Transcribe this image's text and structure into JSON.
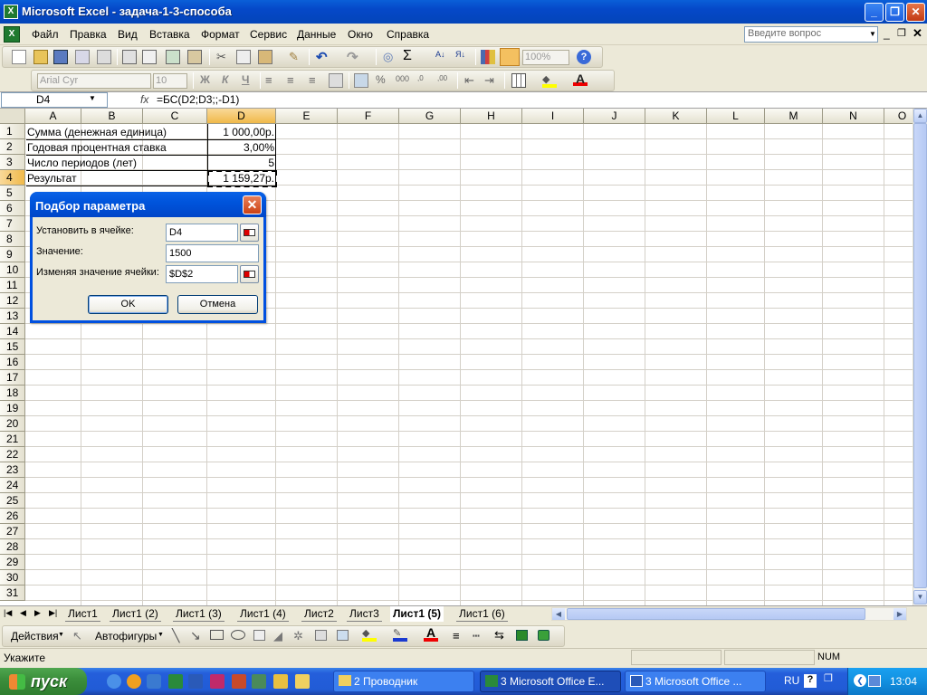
{
  "window": {
    "title": "Microsoft Excel - задача-1-3-способа"
  },
  "menu": {
    "items": [
      "Файл",
      "Правка",
      "Вид",
      "Вставка",
      "Формат",
      "Сервис",
      "Данные",
      "Окно",
      "Справка"
    ],
    "ask_placeholder": "Введите вопрос"
  },
  "toolbar": {
    "zoom": "100%",
    "font_name": "Arial Cyr",
    "font_size": "10",
    "bold": "Ж",
    "italic": "К",
    "underline": "Ч"
  },
  "formula_bar": {
    "name_box": "D4",
    "fx": "fx",
    "formula": "=БС(D2;D3;;-D1)"
  },
  "columns": [
    "A",
    "B",
    "C",
    "D",
    "E",
    "F",
    "G",
    "H",
    "I",
    "J",
    "K",
    "L",
    "M",
    "N",
    "O"
  ],
  "rows": [
    "1",
    "2",
    "3",
    "4",
    "5",
    "6",
    "7",
    "8",
    "9",
    "10",
    "11",
    "12",
    "13",
    "14",
    "15",
    "16",
    "17",
    "18",
    "19",
    "20",
    "21",
    "22",
    "23",
    "24",
    "25",
    "26",
    "27",
    "28",
    "29",
    "30",
    "31"
  ],
  "cells": {
    "A1": "Сумма (денежная единица)",
    "D1": "1 000,00р.",
    "A2": "Годовая процентная ставка",
    "D2": "3,00%",
    "A3": "Число периодов (лет)",
    "D3": "5",
    "A4": "Результат",
    "D4": "1 159,27р."
  },
  "sheet_tabs": [
    "Лист1",
    "Лист1 (2)",
    "Лист1 (3)",
    "Лист1 (4)",
    "Лист2",
    "Лист3",
    "Лист1 (5)",
    "Лист1 (6)"
  ],
  "active_tab": "Лист1 (5)",
  "draw_toolbar": {
    "actions": "Действия",
    "autoshapes": "Автофигуры"
  },
  "status": {
    "mode": "Укажите",
    "num": "NUM"
  },
  "dialog": {
    "title": "Подбор параметра",
    "set_cell_label": "Установить в ячейке:",
    "set_cell_value": "D4",
    "value_label": "Значение:",
    "value_value": "1500",
    "changing_label": "Изменяя значение ячейки:",
    "changing_value": "$D$2",
    "ok": "OK",
    "cancel": "Отмена"
  },
  "taskbar": {
    "start": "пуск",
    "items": [
      "2 Проводник",
      "3 Microsoft Office E...",
      "3 Microsoft Office ..."
    ],
    "lang": "RU",
    "time": "13:04"
  },
  "colors": {
    "selection": "#f0b94a",
    "xp_blue": "#0054dc",
    "start_green": "#3c8f3c"
  }
}
